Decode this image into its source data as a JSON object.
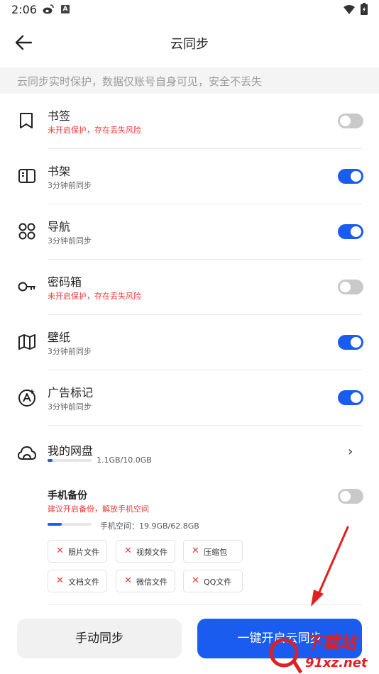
{
  "status_bar": {
    "time": "2:06",
    "a_badge": "A"
  },
  "header": {
    "title": "云同步"
  },
  "notice": {
    "text": "云同步实时保护，数据仅账号自身可见，安全不丢失"
  },
  "sync_items": [
    {
      "title": "书签",
      "subtitle": "未开启保护，存在丢失风险",
      "enabled": false,
      "icon": "bookmark-icon"
    },
    {
      "title": "书架",
      "subtitle": "3分钟前同步",
      "enabled": true,
      "icon": "bookshelf-icon"
    },
    {
      "title": "导航",
      "subtitle": "3分钟前同步",
      "enabled": true,
      "icon": "navigation-grid-icon"
    },
    {
      "title": "密码箱",
      "subtitle": "未开启保护，存在丢失风险",
      "enabled": false,
      "icon": "key-icon"
    },
    {
      "title": "壁纸",
      "subtitle": "3分钟前同步",
      "enabled": true,
      "icon": "wallpaper-map-icon"
    },
    {
      "title": "广告标记",
      "subtitle": "3分钟前同步",
      "enabled": true,
      "icon": "ad-mark-icon"
    }
  ],
  "cloud_disk": {
    "title": "我的网盘",
    "usage": "1.1GB/10.0GB",
    "used_fraction": 0.11,
    "chevron": "›"
  },
  "phone_backup": {
    "title": "手机备份",
    "subtitle": "建议开启备份，解放手机空间",
    "enabled": false,
    "space_label": "手机空间：19.9GB/62.8GB",
    "used_fraction": 0.32,
    "chips": [
      "照片文件",
      "视频文件",
      "压缩包",
      "文档文件",
      "微信文件",
      "QQ文件"
    ],
    "chip_mark": "✕"
  },
  "buttons": {
    "manual": "手动同步",
    "one_click": "一键开启云同步"
  },
  "watermark": {
    "line1": "下载站",
    "line2": "91xz.net"
  },
  "colors": {
    "accent": "#1a5cf0",
    "warning": "#f03b3b",
    "toggle_off": "#c9c9c9"
  }
}
